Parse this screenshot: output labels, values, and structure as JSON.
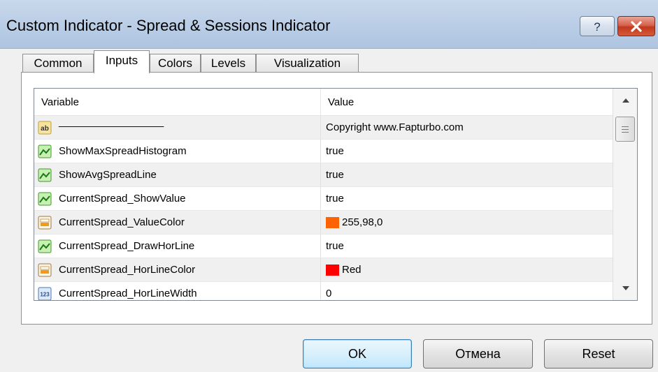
{
  "window": {
    "title": "Custom Indicator - Spread & Sessions Indicator",
    "help_label": "?"
  },
  "tabs": [
    {
      "label": "Common",
      "active": false
    },
    {
      "label": "Inputs",
      "active": true
    },
    {
      "label": "Colors",
      "active": false
    },
    {
      "label": "Levels",
      "active": false
    },
    {
      "label": "Visualization",
      "active": false
    }
  ],
  "grid": {
    "headers": {
      "variable": "Variable",
      "value": "Value"
    },
    "rows": [
      {
        "icon": "string-ab-icon",
        "variable": "__________________",
        "value": "Copyright www.Fapturbo.com"
      },
      {
        "icon": "bool-icon",
        "variable": "ShowMaxSpreadHistogram",
        "value": "true"
      },
      {
        "icon": "bool-icon",
        "variable": "ShowAvgSpreadLine",
        "value": "true"
      },
      {
        "icon": "bool-icon",
        "variable": "CurrentSpread_ShowValue",
        "value": "true"
      },
      {
        "icon": "color-icon",
        "variable": "CurrentSpread_ValueColor",
        "value": "255,98,0",
        "swatch": "#ff6200"
      },
      {
        "icon": "bool-icon",
        "variable": "CurrentSpread_DrawHorLine",
        "value": "true"
      },
      {
        "icon": "color-icon",
        "variable": "CurrentSpread_HorLineColor",
        "value": "Red",
        "swatch": "#ff0000"
      },
      {
        "icon": "int-123-icon",
        "variable": "CurrentSpread_HorLineWidth",
        "value": "0"
      }
    ]
  },
  "buttons": {
    "ok": "OK",
    "cancel": "Отмена",
    "reset": "Reset"
  },
  "colors": {
    "titlebar": "#b9cde6",
    "close_button": "#c0391f",
    "ok_border": "#3c7fb1"
  }
}
